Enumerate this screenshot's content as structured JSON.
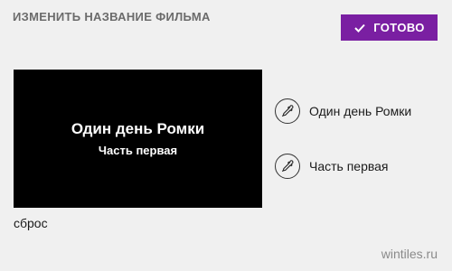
{
  "header": {
    "title": "ИЗМЕНИТЬ НАЗВАНИЕ ФИЛЬМА",
    "done_label": "ГОТОВО",
    "done_icon": "checkmark-icon",
    "accent_color": "#7a1fa2"
  },
  "preview": {
    "title": "Один день Ромки",
    "subtitle": "Часть первая",
    "background_color": "#000000"
  },
  "fields": [
    {
      "icon": "eyedropper-icon",
      "label": "Один день Ромки"
    },
    {
      "icon": "eyedropper-icon",
      "label": "Часть первая"
    }
  ],
  "footer": {
    "reset_label": "сброс",
    "watermark": "wintiles.ru"
  }
}
